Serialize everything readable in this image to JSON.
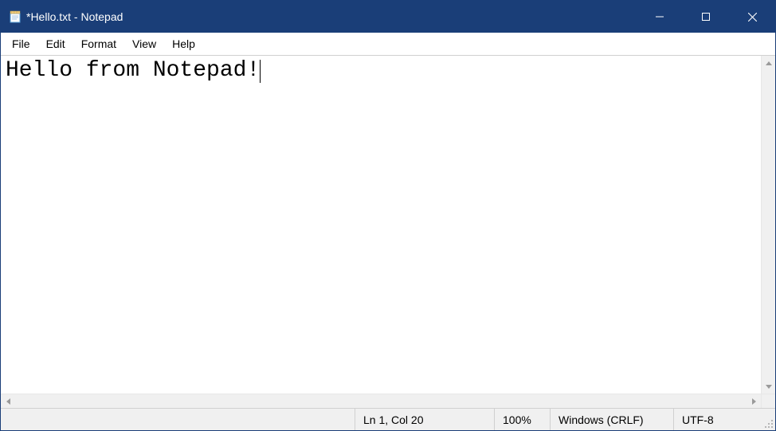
{
  "titlebar": {
    "title": "*Hello.txt - Notepad"
  },
  "menubar": {
    "items": [
      {
        "label": "File"
      },
      {
        "label": "Edit"
      },
      {
        "label": "Format"
      },
      {
        "label": "View"
      },
      {
        "label": "Help"
      }
    ]
  },
  "editor": {
    "content": "Hello from Notepad!"
  },
  "statusbar": {
    "position": "Ln 1, Col 20",
    "zoom": "100%",
    "line_ending": "Windows (CRLF)",
    "encoding": "UTF-8"
  }
}
